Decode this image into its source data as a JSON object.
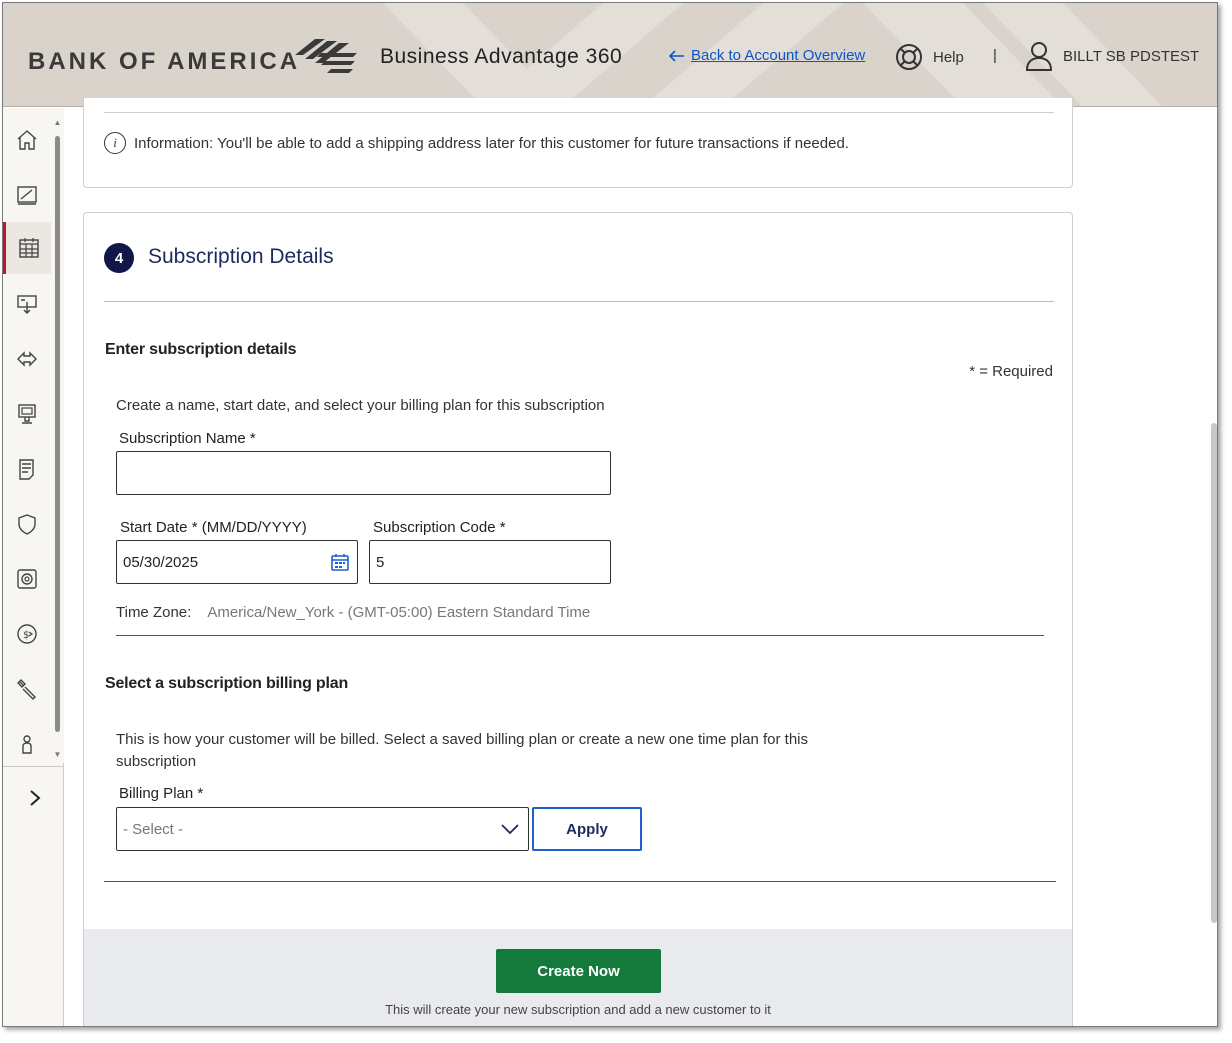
{
  "header": {
    "logo_text": "BANK OF AMERICA",
    "app_title": "Business Advantage 360",
    "back_link": "Back to Account Overview",
    "help": "Help",
    "separator": "|",
    "user_name": "BILLT SB PDSTEST"
  },
  "sidebar": {
    "items": [
      {
        "name": "home-icon",
        "active": false
      },
      {
        "name": "dashboard-icon",
        "active": false
      },
      {
        "name": "calendar-grid-icon",
        "active": true
      },
      {
        "name": "payment-terminal-icon",
        "active": false
      },
      {
        "name": "transfer-arrows-icon",
        "active": false
      },
      {
        "name": "pos-terminal-icon",
        "active": false
      },
      {
        "name": "document-icon",
        "active": false
      },
      {
        "name": "shield-icon",
        "active": false
      },
      {
        "name": "safe-icon",
        "active": false
      },
      {
        "name": "dollar-exchange-icon",
        "active": false
      },
      {
        "name": "tools-icon",
        "active": false
      },
      {
        "name": "person-icon",
        "active": false
      }
    ],
    "expand_icon": "chevron-right-icon"
  },
  "info": {
    "text": "Information: You'll be able to add a shipping address later for this customer for future transactions if needed."
  },
  "subscription": {
    "step": "4",
    "title": "Subscription Details",
    "subheading": "Enter subscription details",
    "required_note": "* = Required",
    "description": "Create a name, start date, and select your billing plan for this subscription",
    "name_label": "Subscription Name *",
    "name_value": "",
    "start_date_label": "Start Date * (MM/DD/YYYY)",
    "start_date_value": "05/30/2025",
    "code_label": "Subscription Code *",
    "code_value": "5",
    "timezone_label": "Time Zone:",
    "timezone_value": "America/New_York - (GMT-05:00) Eastern Standard Time"
  },
  "billing": {
    "heading": "Select a subscription billing plan",
    "description": "This is how your customer will be billed. Select a saved billing plan or create a new one time plan for this subscription",
    "plan_label": "Billing Plan *",
    "plan_selected": "- Select -",
    "apply_label": "Apply"
  },
  "footer": {
    "create_label": "Create Now",
    "create_note": "This will create your new subscription and add a new customer to it"
  },
  "colors": {
    "brand_navy": "#12174a",
    "title_navy": "#1f2a5c",
    "link_blue": "#0b56c9",
    "create_green": "#137a3c",
    "active_red": "#c41230"
  }
}
